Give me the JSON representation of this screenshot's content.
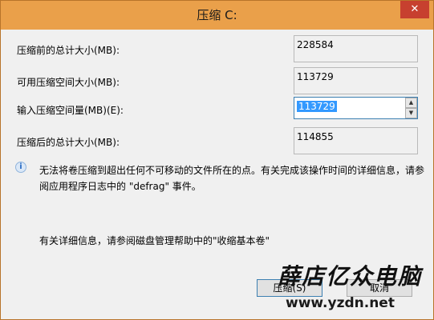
{
  "window": {
    "title": "压缩 C:",
    "close_label": "✕"
  },
  "form": {
    "total_before": {
      "label": "压缩前的总计大小(MB):",
      "value": "228584"
    },
    "available": {
      "label": "可用压缩空间大小(MB):",
      "value": "113729"
    },
    "input": {
      "label": "输入压缩空间量(MB)(E):",
      "value": "113729"
    },
    "total_after": {
      "label": "压缩后的总计大小(MB):",
      "value": "114855"
    }
  },
  "info": {
    "icon": "info-icon",
    "message": "无法将卷压缩到超出任何不可移动的文件所在的点。有关完成该操作时间的详细信息，请参阅应用程序日志中的 \"defrag\" 事件。",
    "help": "有关详细信息，请参阅磁盘管理帮助中的\"收缩基本卷\""
  },
  "buttons": {
    "shrink": "压缩(S)",
    "cancel": "取消"
  },
  "watermark": {
    "name": "薛店亿众电脑",
    "url": "www.yzdn.net"
  }
}
